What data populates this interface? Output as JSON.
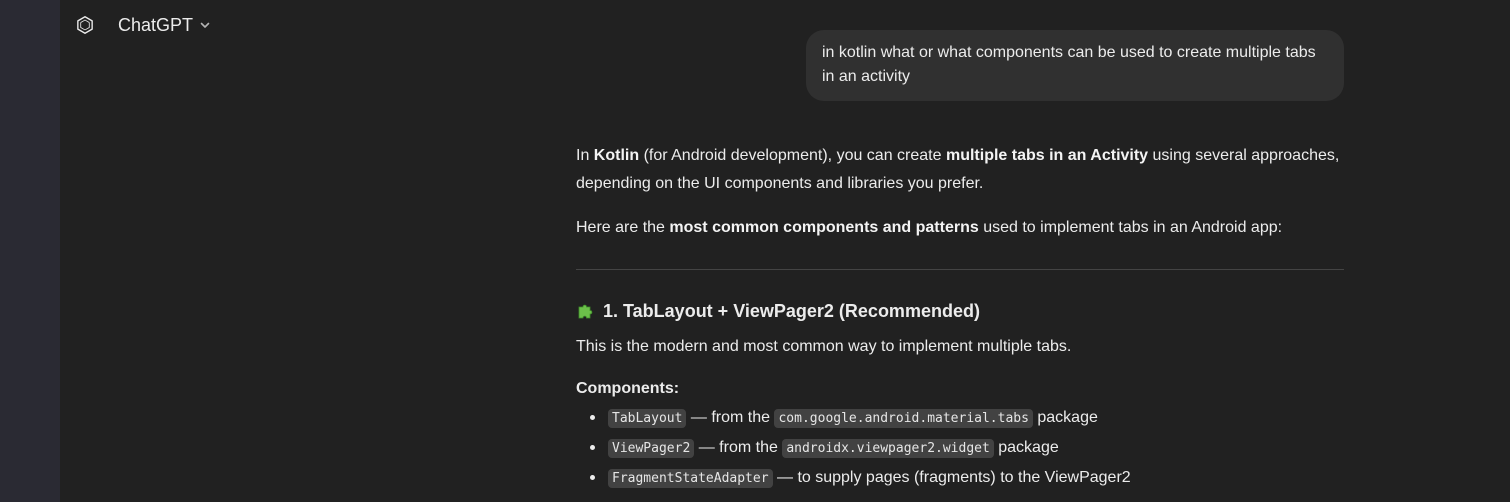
{
  "header": {
    "model_name": "ChatGPT",
    "logo_icon": "openai-logo-icon",
    "chevron_icon": "chevron-down-icon"
  },
  "user_message": {
    "text": "in kotlin what or what components can be used to create multiple tabs in an activity"
  },
  "response": {
    "intro": {
      "t1": "In ",
      "b1": "Kotlin",
      "t2": " (for Android development), you can create ",
      "b2": "multiple tabs in an Activity",
      "t3": " using several approaches, depending on the UI components and libraries you prefer."
    },
    "second": {
      "t1": "Here are the ",
      "b1": "most common components and patterns",
      "t2": " used to implement tabs in an Android app:"
    },
    "section1": {
      "icon": "puzzle-piece-icon",
      "title": "1. TabLayout + ViewPager2 (Recommended)",
      "description": "This is the modern and most common way to implement multiple tabs.",
      "components_label": "Components:",
      "items": [
        {
          "code": "TabLayout",
          "mid": " — from the ",
          "code2": "com.google.android.material.tabs",
          "end": " package"
        },
        {
          "code": "ViewPager2",
          "mid": " — from the ",
          "code2": "androidx.viewpager2.widget",
          "end": " package"
        },
        {
          "code": "FragmentStateAdapter",
          "mid": " — to supply pages (fragments) to the ViewPager2",
          "code2": "",
          "end": ""
        }
      ]
    }
  },
  "colors": {
    "background": "#212121",
    "sidebar_strip": "#2a2a33",
    "user_bubble": "#303030",
    "code_bg": "#424242",
    "text": "#ececec"
  }
}
